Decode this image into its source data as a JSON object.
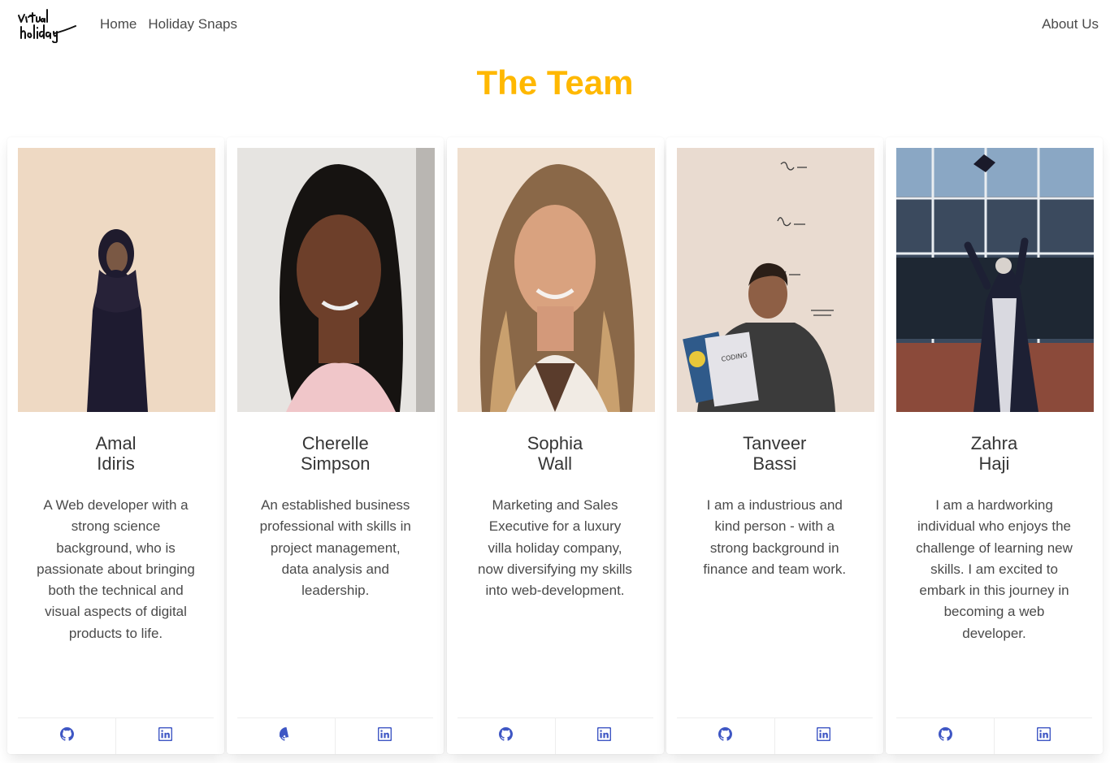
{
  "nav": {
    "logo_text": "virtual holiday",
    "links": [
      "Home",
      "Holiday Snaps"
    ],
    "right_link": "About Us"
  },
  "page_title": "The Team",
  "accent_color": "#ffb800",
  "icon_color": "#3e56c4",
  "members": [
    {
      "first": "Amal",
      "last": "Idiris",
      "bio": "A Web developer with a strong science background, who is passionate about bringing both the technical and visual aspects of digital products to life.",
      "photo": "woman-in-dark-hijab-photo",
      "links": [
        "github-icon",
        "linkedin-icon"
      ]
    },
    {
      "first": "Cherelle",
      "last": "Simpson",
      "bio": "An established business professional with skills in project management, data analysis and leadership.",
      "photo": "smiling-woman-long-dark-hair-photo",
      "links": [
        "github-icon",
        "linkedin-icon"
      ]
    },
    {
      "first": "Sophia",
      "last": "Wall",
      "bio": "Marketing and Sales Executive for a luxury villa holiday company, now diversifying my skills into web-development.",
      "photo": "smiling-woman-blonde-highlights-photo",
      "links": [
        "github-icon",
        "linkedin-icon"
      ]
    },
    {
      "first": "Tanveer",
      "last": "Bassi",
      "bio": "I am a industrious and kind person - with a strong background in finance and team work.",
      "photo": "man-reading-coding-for-dummies-photo",
      "links": [
        "github-icon",
        "linkedin-icon"
      ]
    },
    {
      "first": "Zahra",
      "last": "Haji",
      "bio": "I am a hardworking individual who enjoys the challenge of learning new skills. I am excited to embark in this journey in becoming a web developer.",
      "photo": "graduate-throwing-cap-photo",
      "links": [
        "github-icon",
        "linkedin-icon"
      ]
    }
  ]
}
